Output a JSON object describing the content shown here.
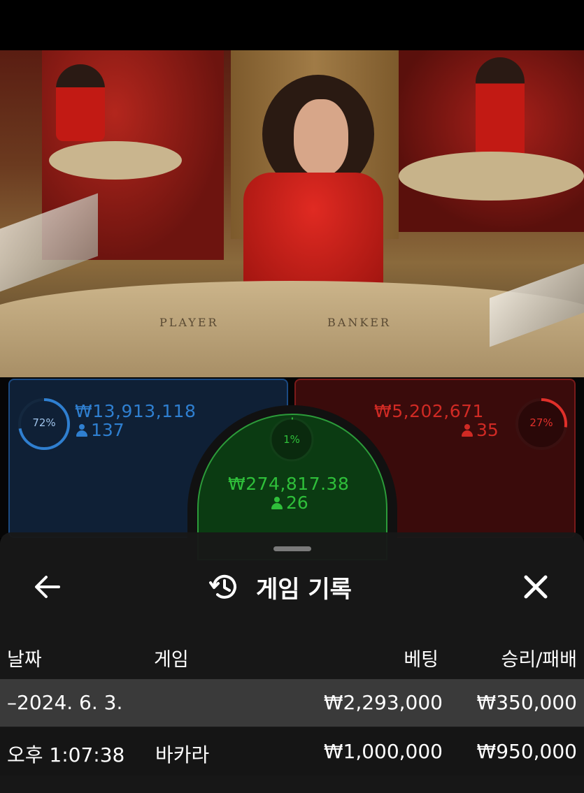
{
  "video": {
    "table_left_label": "PLAYER",
    "table_right_label": "BANKER"
  },
  "bets": {
    "player": {
      "percent_label": "72%",
      "percent": 72,
      "amount": "₩13,913,118",
      "players": "137",
      "color": "#2f7fd0"
    },
    "banker": {
      "percent_label": "27%",
      "percent": 27,
      "amount": "₩5,202,671",
      "players": "35",
      "color": "#e0302a"
    },
    "tie": {
      "percent_label": "1%",
      "percent": 1,
      "amount": "₩274,817.38",
      "players": "26",
      "color": "#2fbf3a"
    }
  },
  "history_panel": {
    "title": "게임 기록",
    "back_icon": "arrow-left-icon",
    "title_icon": "history-icon",
    "close_icon": "close-icon",
    "columns": {
      "date": "날짜",
      "game": "게임",
      "bet": "베팅",
      "win_loss": "승리/패배"
    },
    "rows": [
      {
        "date": "–2024. 6. 3.",
        "game": "",
        "bet": "₩2,293,000",
        "win_loss": "₩350,000"
      },
      {
        "date": "오후 1:07:38",
        "game": "바카라",
        "bet": "₩1,000,000",
        "win_loss": "₩950,000"
      }
    ]
  }
}
